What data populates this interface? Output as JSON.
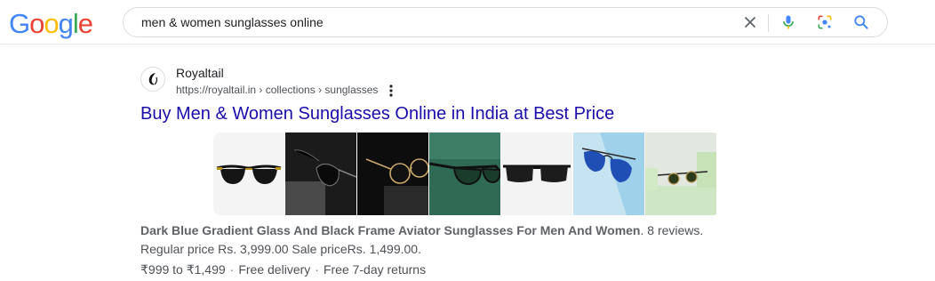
{
  "header": {
    "logo_letters": [
      {
        "ch": "G",
        "color": "#4285F4"
      },
      {
        "ch": "o",
        "color": "#EA4335"
      },
      {
        "ch": "o",
        "color": "#FBBC05"
      },
      {
        "ch": "g",
        "color": "#4285F4"
      },
      {
        "ch": "l",
        "color": "#34A853"
      },
      {
        "ch": "e",
        "color": "#EA4335"
      }
    ],
    "search_query": "men & women sunglasses online",
    "icons": [
      "close-icon",
      "mic-icon",
      "lens-icon",
      "search-icon"
    ]
  },
  "result": {
    "site_name": "Royaltail",
    "url": "https://royaltail.in › collections › sunglasses",
    "title": "Buy Men & Women Sunglasses Online in India at Best Price",
    "thumbnails": [
      {
        "label": "clubmaster-sunglasses-thumbnail"
      },
      {
        "label": "aviator-dark-thumbnail"
      },
      {
        "label": "round-gold-frame-thumbnail"
      },
      {
        "label": "green-wayfarer-thumbnail"
      },
      {
        "label": "black-square-thumbnail"
      },
      {
        "label": "blue-aviator-thumbnail"
      },
      {
        "label": "mint-display-thumbnail"
      }
    ],
    "snippet_bold": "Dark Blue Gradient Glass And Black Frame Aviator Sunglasses For Men And Women",
    "snippet_rest": ". 8 reviews.",
    "price_text": "Regular price Rs. 3,999.00 Sale priceRs. 1,499.00.",
    "price_range": "₹999 to ₹1,499",
    "delivery": "Free delivery",
    "returns": "Free 7-day returns",
    "colors": {
      "title_link": "#1a0dab",
      "text": "#4d5156"
    }
  }
}
